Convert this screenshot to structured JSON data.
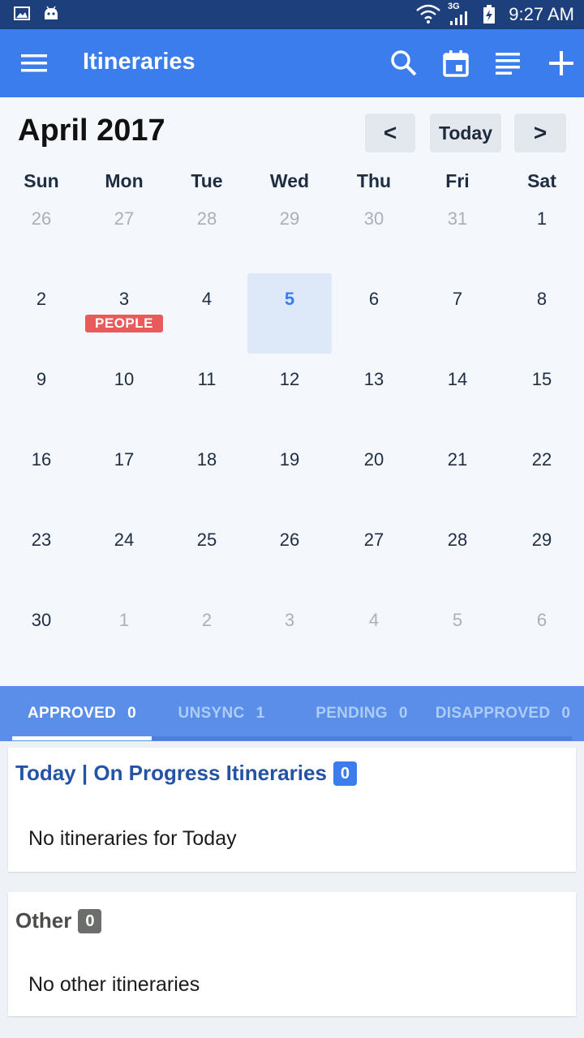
{
  "status_bar": {
    "time": "9:27 AM",
    "network": "3G",
    "icons": [
      "image-icon",
      "android-icon",
      "wifi-icon",
      "signal-icon",
      "battery-icon"
    ]
  },
  "app_bar": {
    "title": "Itineraries",
    "actions": [
      "menu-icon",
      "search-icon",
      "calendar-icon",
      "list-icon",
      "add-icon"
    ]
  },
  "calendar": {
    "month_title": "April 2017",
    "prev_label": "<",
    "today_label": "Today",
    "next_label": ">",
    "weekdays": [
      "Sun",
      "Mon",
      "Tue",
      "Wed",
      "Thu",
      "Fri",
      "Sat"
    ],
    "weeks": [
      [
        "26",
        "27",
        "28",
        "29",
        "30",
        "31",
        "1"
      ],
      [
        "2",
        "3",
        "4",
        "5",
        "6",
        "7",
        "8"
      ],
      [
        "9",
        "10",
        "11",
        "12",
        "13",
        "14",
        "15"
      ],
      [
        "16",
        "17",
        "18",
        "19",
        "20",
        "21",
        "22"
      ],
      [
        "23",
        "24",
        "25",
        "26",
        "27",
        "28",
        "29"
      ],
      [
        "30",
        "1",
        "2",
        "3",
        "4",
        "5",
        "6"
      ]
    ],
    "selected_day": "5",
    "event_badge": "PEOPLE"
  },
  "tabs": [
    {
      "label": "APPROVED",
      "count": "0",
      "active": true
    },
    {
      "label": "UNSYNC",
      "count": "1",
      "active": false
    },
    {
      "label": "PENDING",
      "count": "0",
      "active": false
    },
    {
      "label": "DISAPPROVED",
      "count": "0",
      "active": false
    }
  ],
  "today_section": {
    "title": "Today | On Progress Itineraries",
    "count": "0",
    "empty_text": "No itineraries for Today"
  },
  "other_section": {
    "title": "Other",
    "count": "0",
    "empty_text": "No other itineraries"
  },
  "colors": {
    "app_bar": "#3b7ded",
    "status_bar": "#1d3f7c",
    "tab_bar": "#5b8ee8",
    "badge_red": "#e95a5a",
    "heading_blue": "#2453a6",
    "other_badge": "#6b6e6b"
  }
}
